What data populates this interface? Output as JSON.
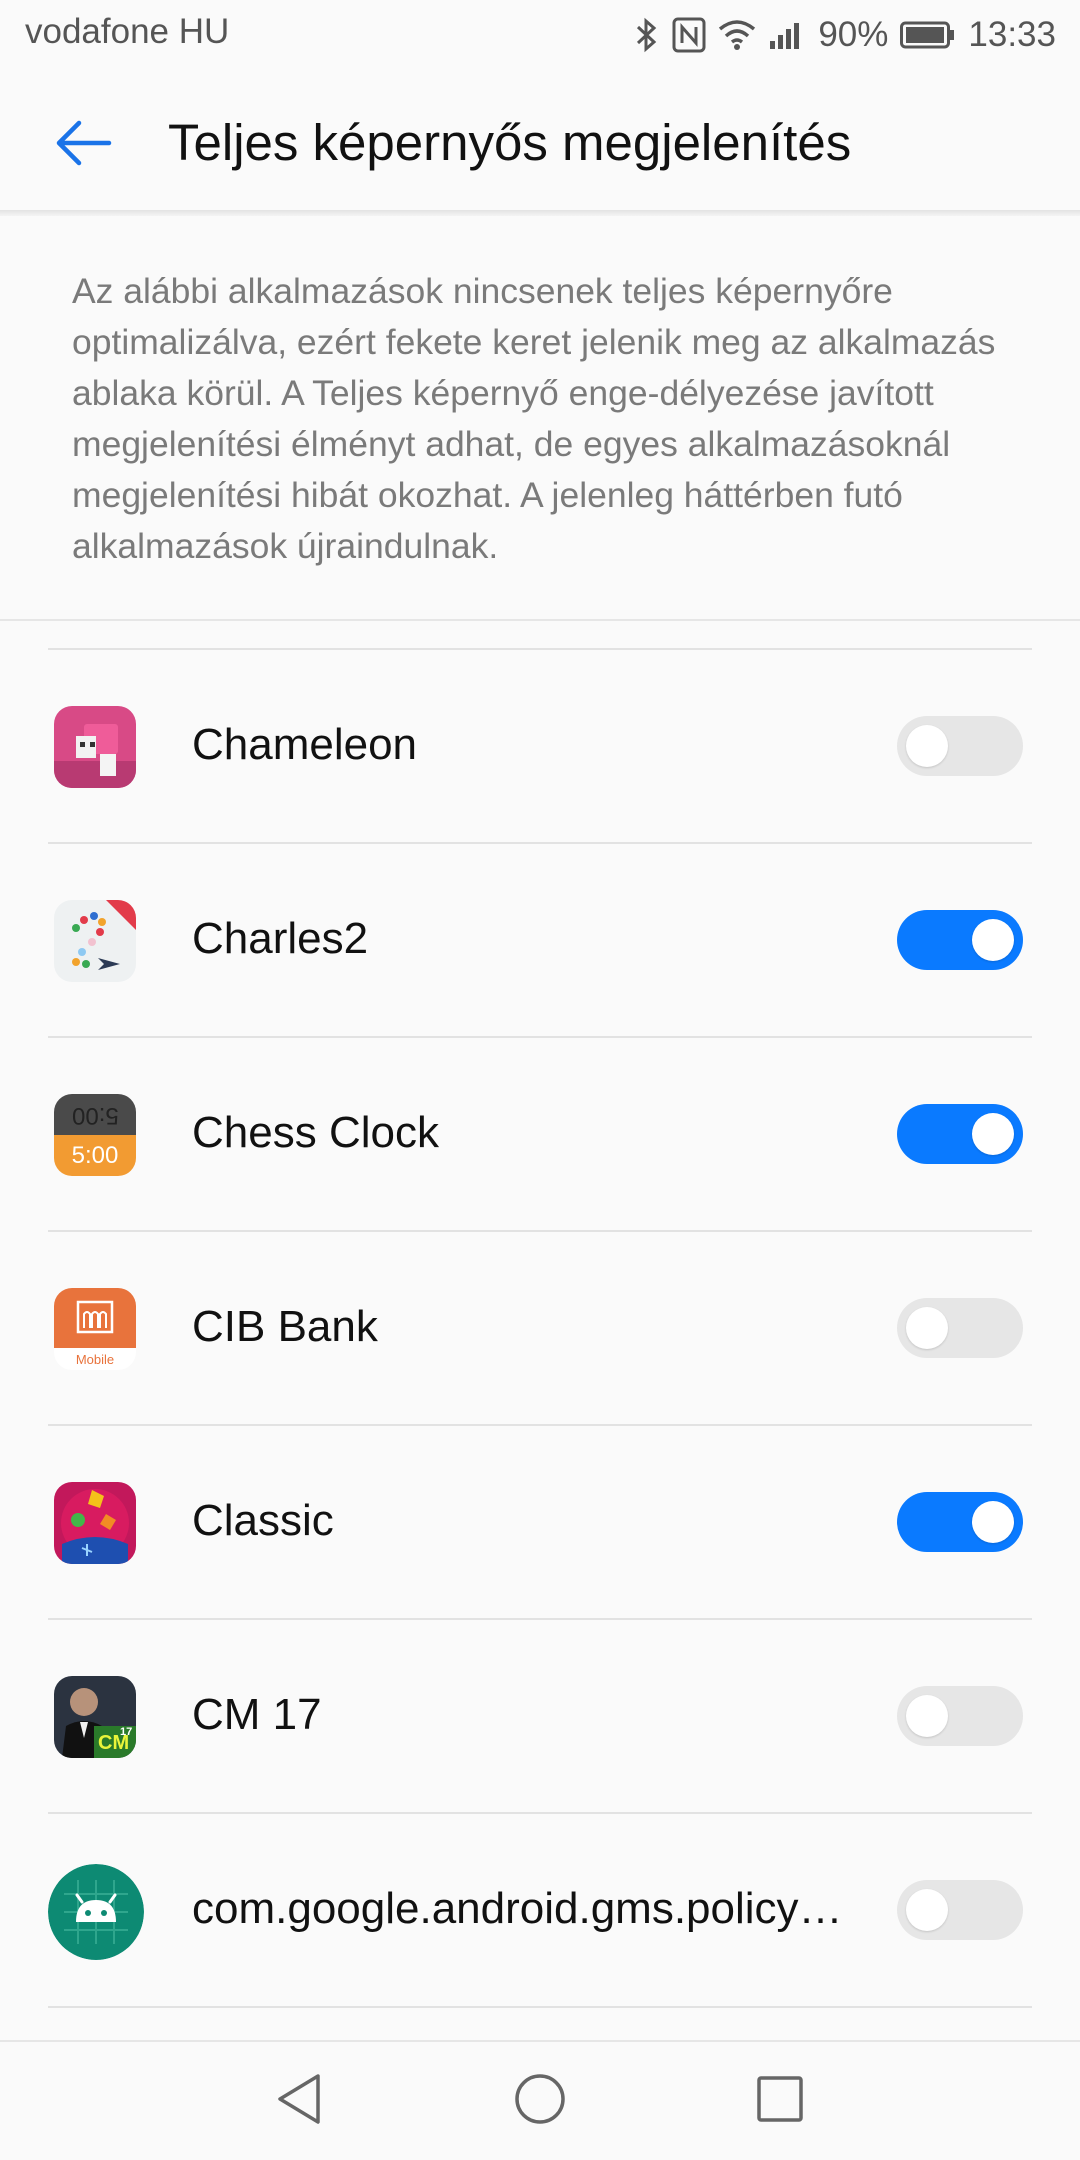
{
  "status_bar": {
    "carrier": "vodafone HU",
    "battery": "90%",
    "time": "13:33",
    "icons": [
      "bluetooth-icon",
      "nfc-icon",
      "wifi-icon",
      "signal-icon",
      "battery-icon"
    ]
  },
  "header": {
    "title": "Teljes képernyős megjelenítés",
    "back_icon": "back-arrow-icon",
    "accent_color": "#1a73e8"
  },
  "description": "Az alábbi alkalmazások nincsenek teljes képernyőre optimalizálva, ezért fekete keret jelenik meg az alkalmazás ablaka körül. A Teljes képernyő enge-délyezése javított megjelenítési élményt adhat, de egyes alkalmazásoknál megjelenítési hibát okozhat. A jelenleg háttérben futó alkalmazások újraindulnak.",
  "apps": [
    {
      "name": "Chameleon",
      "icon": "chameleon-icon",
      "enabled": false
    },
    {
      "name": "Charles2",
      "icon": "charles2-icon",
      "enabled": true
    },
    {
      "name": "Chess Clock",
      "icon": "chess-clock-icon",
      "enabled": true,
      "icon_text_top": "5:00",
      "icon_text_bottom": "5:00"
    },
    {
      "name": "CIB Bank",
      "icon": "cib-bank-icon",
      "enabled": false,
      "icon_text": "Mobile"
    },
    {
      "name": "Classic",
      "icon": "classic-icon",
      "enabled": true
    },
    {
      "name": "CM 17",
      "icon": "cm17-icon",
      "enabled": false,
      "icon_text": "CM",
      "icon_badge": "17"
    },
    {
      "name": "com.google.android.gms.policy…",
      "icon": "android-icon",
      "enabled": false
    }
  ],
  "toggle_colors": {
    "on": "#0a7aff",
    "off": "#e6e6e6"
  },
  "nav_bar": {
    "buttons": [
      "back-triangle-icon",
      "home-circle-icon",
      "recents-square-icon"
    ]
  }
}
